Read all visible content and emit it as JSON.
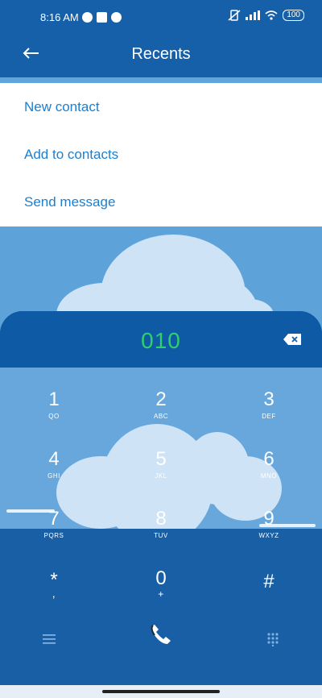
{
  "status": {
    "time": "8:16 AM",
    "battery": "100"
  },
  "header": {
    "title": "Recents"
  },
  "menu": {
    "items": [
      "New contact",
      "Add to contacts",
      "Send message"
    ]
  },
  "dialer": {
    "number": "010",
    "keys": [
      {
        "digit": "1",
        "letters": "QO"
      },
      {
        "digit": "2",
        "letters": "ABC"
      },
      {
        "digit": "3",
        "letters": "DEF"
      },
      {
        "digit": "4",
        "letters": "GHI"
      },
      {
        "digit": "5",
        "letters": "JKL"
      },
      {
        "digit": "6",
        "letters": "MNO"
      },
      {
        "digit": "7",
        "letters": "PQRS"
      },
      {
        "digit": "8",
        "letters": "TUV"
      },
      {
        "digit": "9",
        "letters": "WXYZ"
      },
      {
        "digit": "*",
        "letters": ","
      },
      {
        "digit": "0",
        "letters": "+"
      },
      {
        "digit": "#",
        "letters": ""
      }
    ]
  },
  "colors": {
    "accent": "#1c7fd0",
    "number": "#2fcf6b",
    "header": "#1560a8"
  },
  "icons": [
    "back-arrow-icon",
    "backspace-icon",
    "menu-icon",
    "call-icon",
    "dialpad-icon"
  ]
}
